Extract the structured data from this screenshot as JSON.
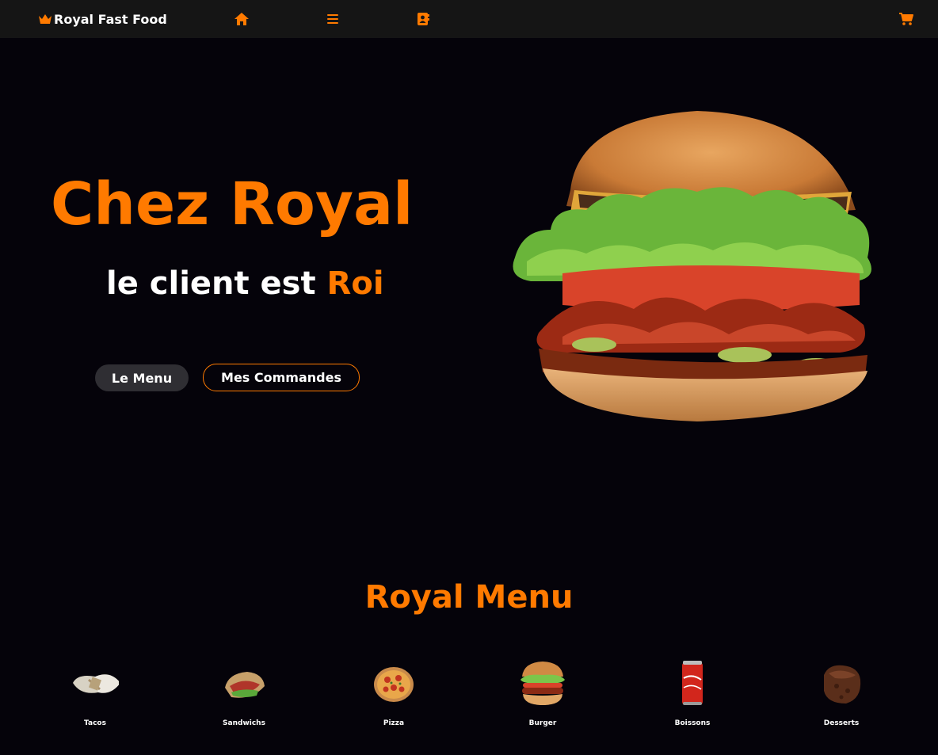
{
  "navbar": {
    "brand": "Royal Fast Food",
    "brand_icon": "crown-icon",
    "icons": [
      "home-icon",
      "menu-list-icon",
      "contact-book-icon",
      "cart-icon"
    ]
  },
  "hero": {
    "title": "Chez Royal",
    "subtitle_prefix": "le client est ",
    "subtitle_accent": "Roi",
    "buttons": {
      "menu": "Le Menu",
      "orders": "Mes Commandes"
    }
  },
  "menu_section": {
    "heading": "Royal Menu",
    "categories": [
      {
        "label": "Tacos",
        "icon": "tacos-image"
      },
      {
        "label": "Sandwichs",
        "icon": "sandwich-image"
      },
      {
        "label": "Pizza",
        "icon": "pizza-image"
      },
      {
        "label": "Burger",
        "icon": "burger-image"
      },
      {
        "label": "Boissons",
        "icon": "soda-can-image"
      },
      {
        "label": "Desserts",
        "icon": "brownie-image"
      }
    ]
  },
  "colors": {
    "accent": "#ff7a00",
    "background": "#05030a",
    "navbar": "#151515",
    "button_dark": "#2f2e33"
  }
}
